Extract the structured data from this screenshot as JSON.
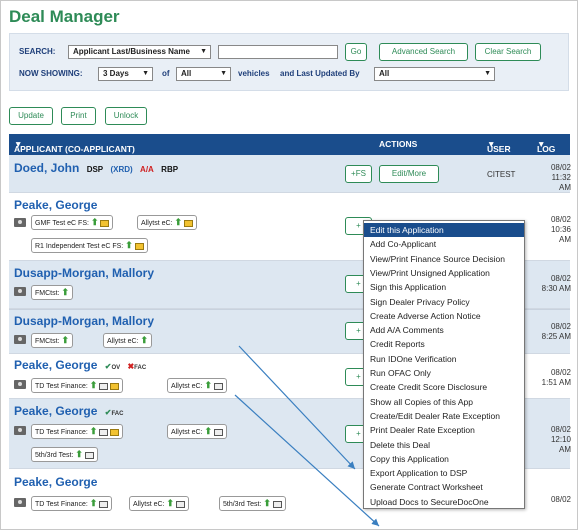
{
  "app": {
    "title": "Deal Manager"
  },
  "search": {
    "label": "SEARCH:",
    "field": "Applicant Last/Business Name",
    "value": "",
    "go": "Go",
    "advanced": "Advanced Search",
    "clear": "Clear Search"
  },
  "showing": {
    "label": "NOW SHOWING:",
    "days": "3 Days",
    "of": "of",
    "vehicles_sel": "All",
    "vehicles": "vehicles",
    "updated_by": "and Last Updated By",
    "user_sel": "All"
  },
  "toolbar": {
    "update": "Update",
    "print": "Print",
    "unlock": "Unlock"
  },
  "table": {
    "col_applicant": "APPLICANT (CO-APPLICANT)",
    "col_actions": "ACTIONS",
    "col_user": "USER",
    "col_log": "LOG"
  },
  "rows": [
    {
      "name": "Doed, John",
      "dsp": "DSP",
      "xrd": "(XRD)",
      "aa": "A/A",
      "rbp": "RBP",
      "fs": "+FS",
      "edit": "Edit/More",
      "user": "CITEST",
      "date": "08/02",
      "time": "11:32 AM"
    },
    {
      "name": "Peake, George",
      "chips": [
        "GMF Test eC FS:",
        "Allytst eC:",
        "R1 Independent Test eC FS:"
      ],
      "date": "08/02",
      "time": "10:36 AM"
    },
    {
      "name": "Dusapp-Morgan, Mallory",
      "chips": [
        "FMCtst:"
      ],
      "date": "08/02",
      "time": "8:30 AM"
    },
    {
      "name": "Dusapp-Morgan, Mallory",
      "chips": [
        "FMCtst:",
        "Allytst eC:"
      ],
      "date": "08/02",
      "time": "8:25 AM"
    },
    {
      "name": "Peake, George",
      "ov": "OV",
      "ofac": "FAC",
      "chips": [
        "TD Test Finance:",
        "Allytst eC:"
      ],
      "date": "08/02",
      "time": "1:51 AM"
    },
    {
      "name": "Peake, George",
      "ofac": "FAC",
      "chips": [
        "TD Test Finance:",
        "Allytst eC:",
        "5th/3rd Test:"
      ],
      "date": "08/02",
      "time": "12:10 AM"
    },
    {
      "name": "Peake, George",
      "chips": [
        "TD Test Finance:",
        "Allytst eC:",
        "5th/3rd Test:"
      ],
      "date": "08/02",
      "time": ""
    }
  ],
  "menu": {
    "items": [
      "Edit this Application",
      "Add Co-Applicant",
      "View/Print Finance Source Decision",
      "View/Print Unsigned Application",
      "Sign this Application",
      "Sign Dealer Privacy Policy",
      "Create Adverse Action Notice",
      "Add A/A Comments",
      "Credit Reports",
      "Run IDOne Verification",
      "Run OFAC Only",
      "Create Credit Score Disclosure",
      "Show all Copies of this App",
      "Create/Edit Dealer Rate Exception",
      "Print Dealer Rate Exception",
      "Delete this Deal",
      "Copy this Application",
      "Export Application to DSP",
      "Generate Contract Worksheet",
      "Upload Docs to SecureDocOne"
    ]
  },
  "colors": {
    "brand_green": "#2e8b57",
    "header_blue": "#1a4d8c",
    "link_blue": "#2060b0",
    "row_shade": "#dde7f1"
  }
}
